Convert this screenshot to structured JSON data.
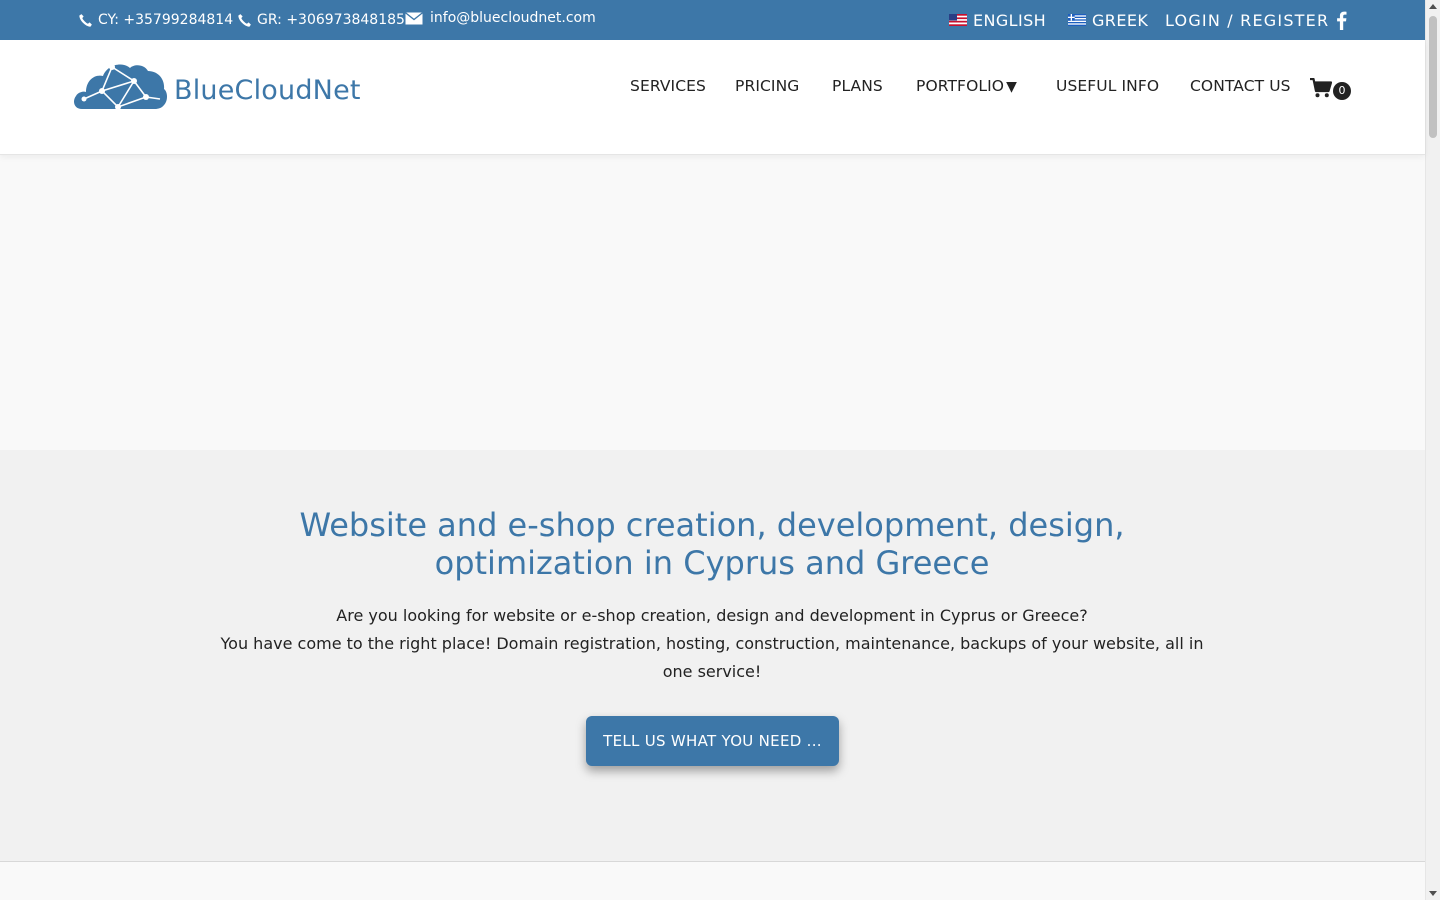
{
  "topbar": {
    "phone_cy": "CY: +35799284814",
    "phone_gr": "GR: +306973848185",
    "email": "info@bluecloudnet.com",
    "lang_english": "ENGLISH",
    "lang_greek": "GREEK",
    "login_register": "LOGIN / REGISTER",
    "social_icon": "facebook-icon"
  },
  "header": {
    "logo_text": "BlueCloudNet",
    "nav": [
      "SERVICES",
      "PRICING",
      "PLANS",
      "PORTFOLIO",
      "USEFUL INFO",
      "CONTACT US"
    ],
    "portfolio_caret": "▼",
    "cart_count": "0"
  },
  "intro": {
    "title_line1": "Website and e-shop creation, development, design,",
    "title_line2": "optimization in Cyprus and Greece",
    "text_line1": "Are you looking for website or e-shop creation, design and development in Cyprus or Greece?",
    "text_line2": "You have come to the right place! Domain registration, hosting, construction, maintenance, backups of your website, all in one service!",
    "cta_label": "TELL US WHAT YOU NEED ..."
  },
  "colors": {
    "brand": "#3d77a8",
    "section_bg": "#f1f1f1",
    "page_bg": "#f9f9f9"
  }
}
